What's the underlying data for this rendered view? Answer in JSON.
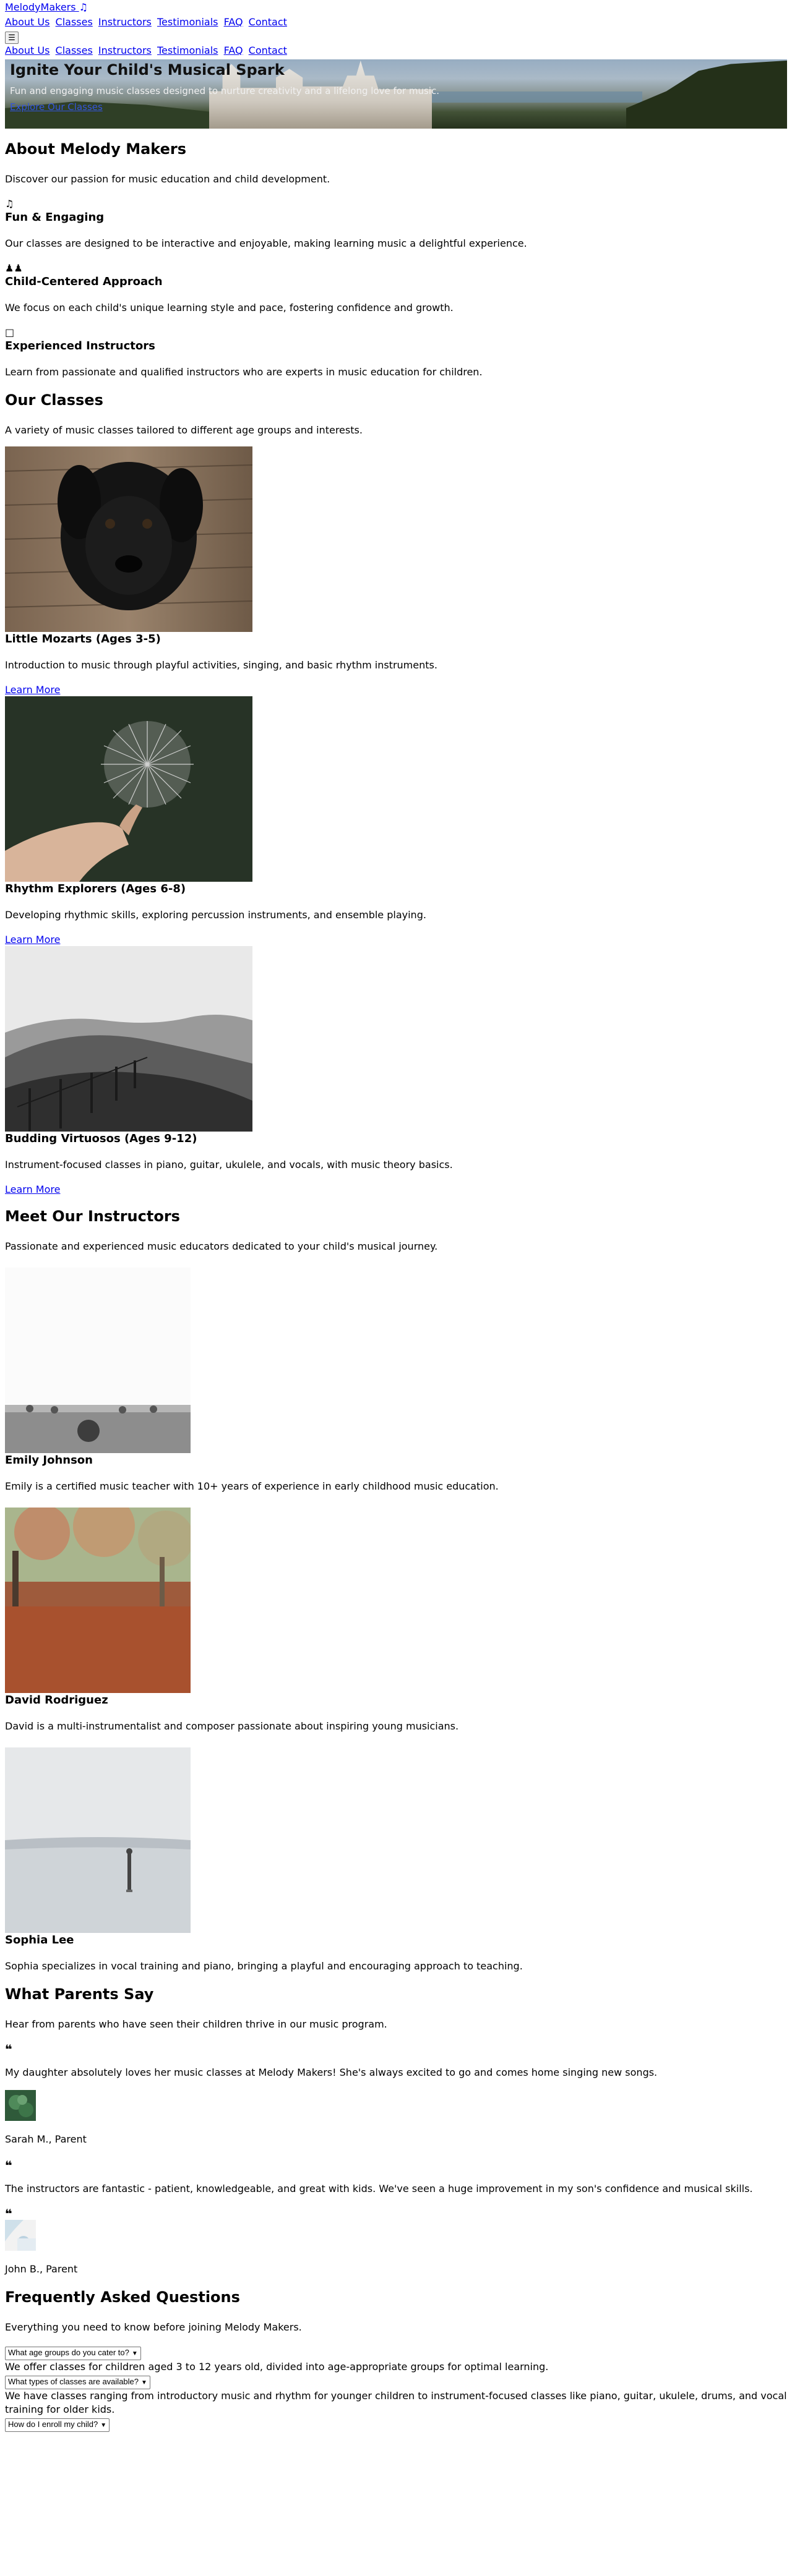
{
  "header": {
    "brand": "MelodyMakers",
    "nav": [
      "About Us",
      "Classes",
      "Instructors",
      "Testimonials",
      "FAQ",
      "Contact"
    ],
    "menu_icon": "hamburger-icon",
    "mobile_nav": [
      "About Us",
      "Classes",
      "Instructors",
      "Testimonials",
      "FAQ",
      "Contact"
    ]
  },
  "hero": {
    "title": "Ignite Your Child's Musical Spark",
    "subtitle": "Fun and engaging music classes designed to nurture creativity and a lifelong love for music.",
    "cta": "Explore Our Classes"
  },
  "about": {
    "title": "About Melody Makers",
    "intro": "Discover our passion for music education and child development.",
    "features": [
      {
        "icon": "music-note-icon",
        "title": "Fun & Engaging",
        "text": "Our classes are designed to be interactive and enjoyable, making learning music a delightful experience."
      },
      {
        "icon": "children-icon",
        "title": "Child-Centered Approach",
        "text": "We focus on each child's unique learning style and pace, fostering confidence and growth."
      },
      {
        "icon": "teacher-icon",
        "title": "Experienced Instructors",
        "text": "Learn from passionate and qualified instructors who are experts in music education for children."
      }
    ]
  },
  "classes": {
    "title": "Our Classes",
    "intro": "A variety of music classes tailored to different age groups and interests.",
    "items": [
      {
        "title": "Little Mozarts (Ages 3-5)",
        "text": "Introduction to music through playful activities, singing, and basic rhythm instruments.",
        "link": "Learn More"
      },
      {
        "title": "Rhythm Explorers (Ages 6-8)",
        "text": "Developing rhythmic skills, exploring percussion instruments, and ensemble playing.",
        "link": "Learn More"
      },
      {
        "title": "Budding Virtuosos (Ages 9-12)",
        "text": "Instrument-focused classes in piano, guitar, ukulele, and vocals, with music theory basics.",
        "link": "Learn More"
      }
    ]
  },
  "instructors": {
    "title": "Meet Our Instructors",
    "intro": "Passionate and experienced music educators dedicated to your child's musical journey.",
    "items": [
      {
        "name": "Emily Johnson",
        "bio": "Emily is a certified music teacher with 10+ years of experience in early childhood music education."
      },
      {
        "name": "David Rodriguez",
        "bio": "David is a multi-instrumentalist and composer passionate about inspiring young musicians."
      },
      {
        "name": "Sophia Lee",
        "bio": "Sophia specializes in vocal training and piano, bringing a playful and encouraging approach to teaching."
      }
    ]
  },
  "testimonials": {
    "title": "What Parents Say",
    "intro": "Hear from parents who have seen their children thrive in our music program.",
    "items": [
      {
        "quote": "My daughter absolutely loves her music classes at Melody Makers! She's always excited to go and comes home singing new songs.",
        "author": "Sarah M., Parent"
      },
      {
        "quote": "The instructors are fantastic - patient, knowledgeable, and great with kids. We've seen a huge improvement in my son's confidence and musical skills.",
        "author": "John B., Parent"
      }
    ]
  },
  "faq": {
    "title": "Frequently Asked Questions",
    "intro": "Everything you need to know before joining Melody Makers.",
    "items": [
      {
        "question": "What age groups do you cater to?",
        "answer": "We offer classes for children aged 3 to 12 years old, divided into age-appropriate groups for optimal learning."
      },
      {
        "question": "What types of classes are available?",
        "answer": "We have classes ranging from introductory music and rhythm for younger children to instrument-focused classes like piano, guitar, ukulele, drums, and vocal training for older kids."
      },
      {
        "question": "How do I enroll my child?",
        "answer": ""
      }
    ]
  },
  "colors": {
    "link": "#0000ee",
    "text": "#000000",
    "background": "#ffffff"
  }
}
